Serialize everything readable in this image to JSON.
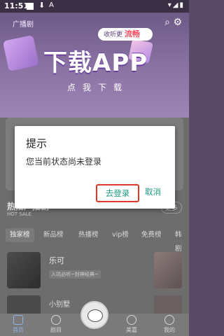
{
  "status_bar": {
    "time": "11:51",
    "download_glyph": "⬇",
    "a_glyph": "A",
    "right_icons": "▾◢▮"
  },
  "banner": {
    "category": "广播剧",
    "pill_prefix": "收听更",
    "pill_highlight": "流畅",
    "headline": "下载APP",
    "sub": "点我下载",
    "toolbar_icons": "⌕ ⚙"
  },
  "section": {
    "title": "热播广播剧",
    "sub": "HOT SALE",
    "more": "更多"
  },
  "tabs": [
    "独家榜",
    "新品榜",
    "热播榜",
    "vip榜",
    "免费榜",
    "韩剧"
  ],
  "list": [
    {
      "name": "乐可",
      "desc": "入坑必听~封神经典~"
    },
    {
      "name": "小别墅"
    }
  ],
  "nav": [
    "首页",
    "剧目",
    "",
    "美嘉",
    "我的"
  ],
  "dialog": {
    "title": "提示",
    "message": "您当前状态尚未登录",
    "login_label": "去登录",
    "cancel_label": "取消"
  }
}
